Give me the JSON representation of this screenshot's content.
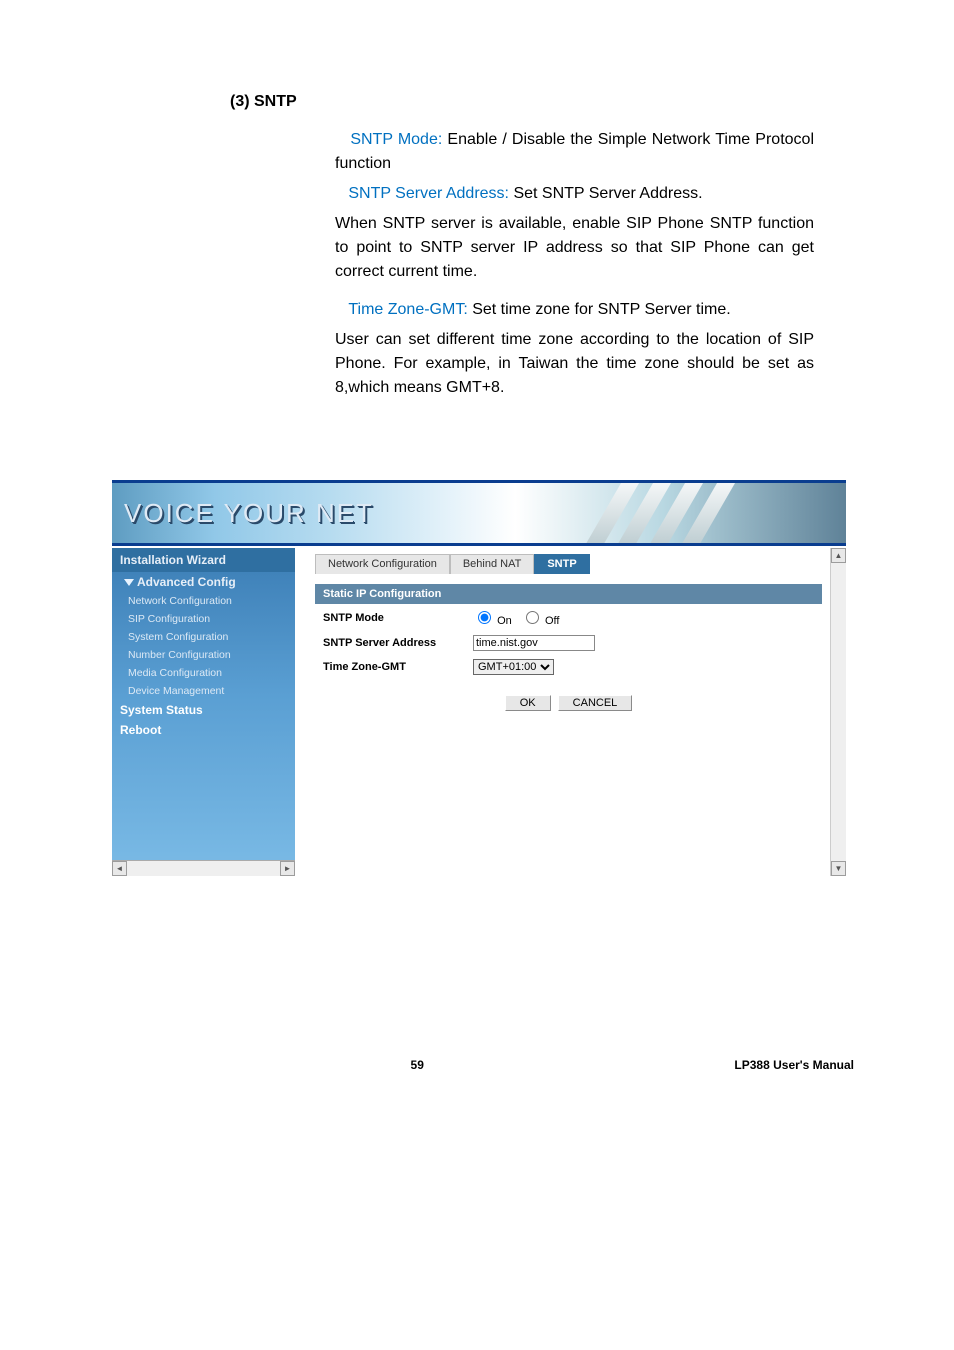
{
  "doc": {
    "section_title": "(3) SNTP",
    "sntp_mode_label": "SNTP Mode: ",
    "sntp_mode_text": "Enable / Disable the Simple Network Time Protocol function",
    "sntp_server_label": "SNTP Server Address: ",
    "sntp_server_text": "Set SNTP Server Address.",
    "sntp_para": "When SNTP server is available, enable SIP Phone SNTP function to point to SNTP server IP address so that SIP Phone can get correct current time.",
    "tz_label": "Time Zone-GMT: ",
    "tz_text": "Set time zone for SNTP Server time.",
    "tz_para": "User can set different time zone according to the location of SIP Phone. For example, in Taiwan the time zone should be set as 8,which means GMT+8."
  },
  "brand": "VOICE YOUR NET",
  "sidebar": {
    "top": "Installation Wizard",
    "group": "Advanced Config",
    "subs": [
      "Network Configuration",
      "SIP Configuration",
      "System Configuration",
      "Number Configuration",
      "Media Configuration",
      "Device Management"
    ],
    "system_status": "System Status",
    "reboot": "Reboot"
  },
  "tabs": {
    "netconf": "Network Configuration",
    "behind_nat": "Behind NAT",
    "sntp": "SNTP"
  },
  "panel": {
    "header": "Static IP Configuration",
    "rows": {
      "mode_label": "SNTP Mode",
      "mode_on": "On",
      "mode_off": "Off",
      "server_label": "SNTP Server Address",
      "server_value": "time.nist.gov",
      "tz_label": "Time Zone-GMT",
      "tz_value": "GMT+01:00"
    },
    "ok": "OK",
    "cancel": "CANCEL"
  },
  "footer": {
    "page": "59",
    "manual": "LP388  User's  Manual"
  }
}
